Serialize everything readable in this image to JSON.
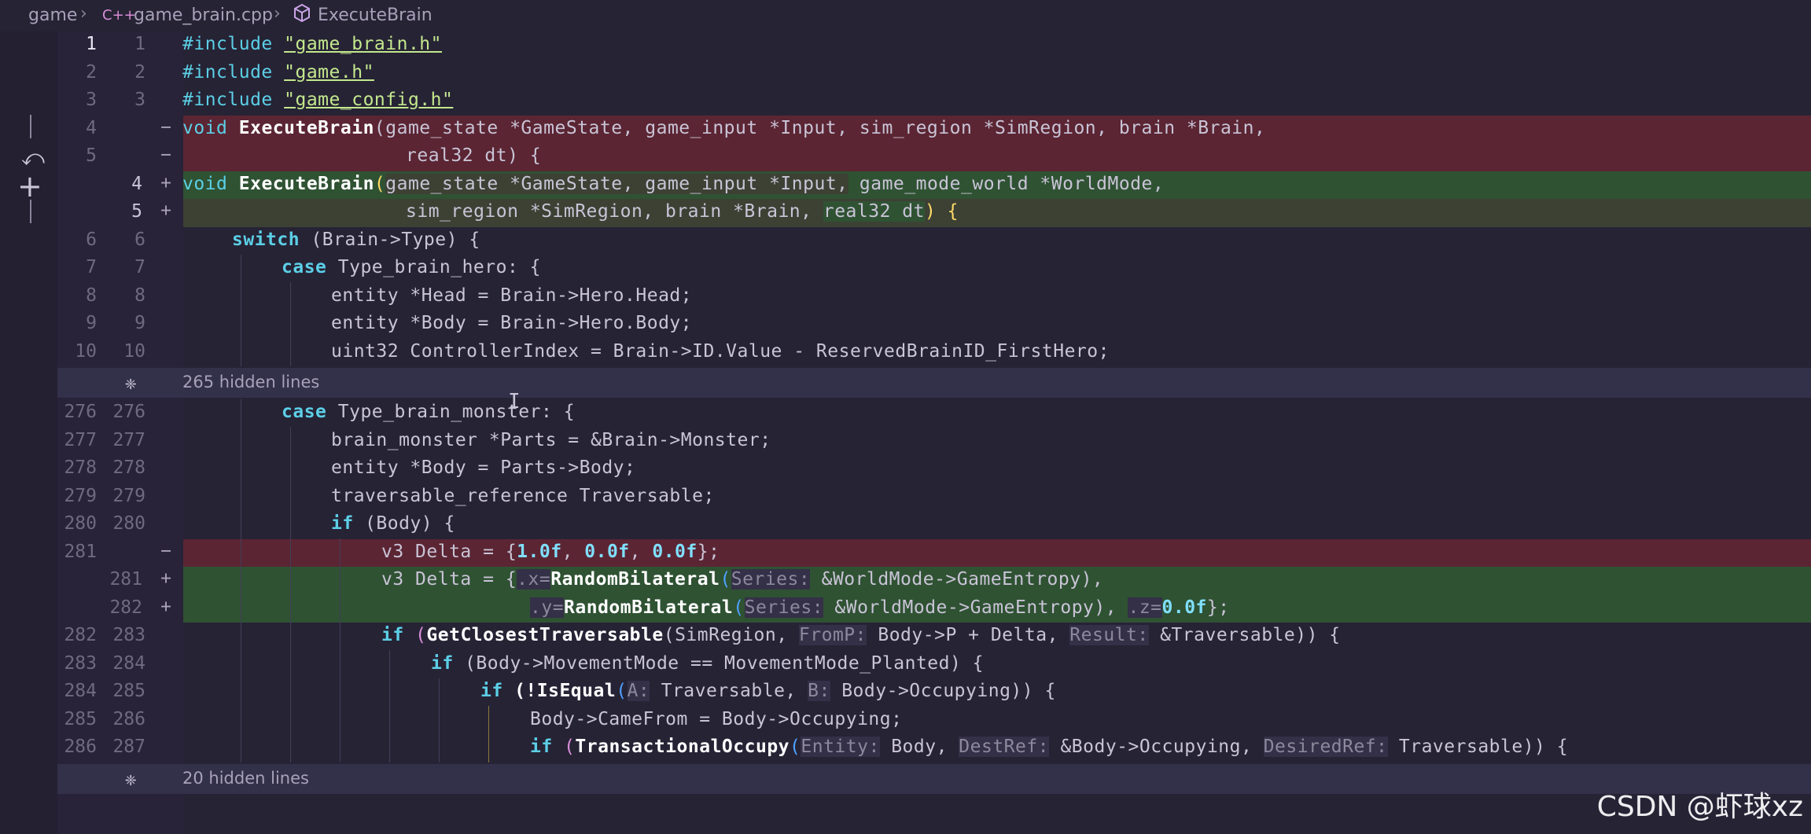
{
  "breadcrumb": {
    "folder": "game",
    "file": "game_brain.cpp",
    "symbol": "ExecuteBrain"
  },
  "hidden_sections": [
    {
      "label": "265 hidden lines"
    },
    {
      "label": "20 hidden lines"
    }
  ],
  "lines": [
    {
      "old": "1",
      "new": "1",
      "kind": "ctx",
      "current": true
    },
    {
      "old": "2",
      "new": "2",
      "kind": "ctx"
    },
    {
      "old": "3",
      "new": "3",
      "kind": "ctx"
    },
    {
      "old": "4",
      "new": "",
      "kind": "del",
      "mark": "−"
    },
    {
      "old": "5",
      "new": "",
      "kind": "del",
      "mark": "−"
    },
    {
      "old": "",
      "new": "4",
      "kind": "add",
      "mark": "+"
    },
    {
      "old": "",
      "new": "5",
      "kind": "addlite",
      "mark": "+"
    },
    {
      "old": "6",
      "new": "6",
      "kind": "ctx"
    },
    {
      "old": "7",
      "new": "7",
      "kind": "ctx"
    },
    {
      "old": "8",
      "new": "8",
      "kind": "ctx"
    },
    {
      "old": "9",
      "new": "9",
      "kind": "ctx"
    },
    {
      "old": "10",
      "new": "10",
      "kind": "ctx"
    },
    {
      "old": "276",
      "new": "276",
      "kind": "ctx"
    },
    {
      "old": "277",
      "new": "277",
      "kind": "ctx"
    },
    {
      "old": "278",
      "new": "278",
      "kind": "ctx"
    },
    {
      "old": "279",
      "new": "279",
      "kind": "ctx"
    },
    {
      "old": "280",
      "new": "280",
      "kind": "ctx"
    },
    {
      "old": "281",
      "new": "",
      "kind": "del",
      "mark": "−"
    },
    {
      "old": "",
      "new": "281",
      "kind": "add",
      "mark": "+"
    },
    {
      "old": "",
      "new": "282",
      "kind": "add",
      "mark": "+"
    },
    {
      "old": "282",
      "new": "283",
      "kind": "ctx"
    },
    {
      "old": "283",
      "new": "284",
      "kind": "ctx"
    },
    {
      "old": "284",
      "new": "285",
      "kind": "ctx"
    },
    {
      "old": "285",
      "new": "286",
      "kind": "ctx"
    },
    {
      "old": "286",
      "new": "287",
      "kind": "ctx"
    }
  ],
  "code": {
    "l1_inc": "#include",
    "l1_str": "\"game_brain.h\"",
    "l2_inc": "#include",
    "l2_str": "\"game.h\"",
    "l3_inc": "#include",
    "l3_str": "\"game_config.h\"",
    "l4_void": "void",
    "l4_fn": "ExecuteBrain",
    "l4_args": "(game_state *GameState, game_input *Input, sim_region *SimRegion, brain *Brain,",
    "l5_args": "real32 dt) {",
    "a4_void": "void",
    "a4_fn": "ExecuteBrain",
    "a4_args1": "game_state *GameState, game_input *Input,",
    "a4_args2": "game_mode_world *WorldMode,",
    "a5_args1": "sim_region *SimRegion, brain *Brain,",
    "a5_args2": "real32 dt",
    "a5_end": ") {",
    "l6_kw": "switch",
    "l6_rest": "(Brain->Type) {",
    "l7_kw": "case",
    "l7_rest": "Type_brain_hero: {",
    "l8": "entity *Head = Brain->Hero.Head;",
    "l9": "entity *Body = Brain->Hero.Body;",
    "l10": "uint32 ControllerIndex = Brain->ID.Value - ReservedBrainID_FirstHero;",
    "l276_kw": "case",
    "l276_rest": "Type_brain_monster: {",
    "l277": "brain_monster *Parts = &Brain->Monster;",
    "l278": "entity *Body = Parts->Body;",
    "l279": "traversable_reference Traversable;",
    "l280_kw": "if",
    "l280_rest": "(Body) {",
    "d281_pre": "v3 Delta = {",
    "d281_n1": "1.0f",
    "d281_n2": "0.0f",
    "d281_n3": "0.0f",
    "d281_end": "};",
    "a281_pre": "v3 Delta = {",
    "a281_x": ".x=",
    "a281_fn": "RandomBilateral",
    "a281_hint": "Series:",
    "a281_arg": "&WorldMode->GameEntropy),",
    "a282_y": ".y=",
    "a282_fn": "RandomBilateral",
    "a282_hint": "Series:",
    "a282_arg": "&WorldMode->GameEntropy),",
    "a282_z": ".z=",
    "a282_num": "0.0f",
    "a282_end": "};",
    "l283_kw": "if",
    "l283_fn": "GetClosestTraversable",
    "l283_a1": "(SimRegion,",
    "l283_h1": "FromP:",
    "l283_a2": "Body->P + Delta,",
    "l283_h2": "Result:",
    "l283_a3": "&Traversable)) {",
    "l284_kw": "if",
    "l284_rest": "(Body->MovementMode == MovementMode_Planted) {",
    "l285_kw": "if",
    "l285_fn": "(!IsEqual",
    "l285_h1": "A:",
    "l285_a1": "Traversable,",
    "l285_h2": "B:",
    "l285_a2": "Body->Occupying)) {",
    "l286": "Body->CameFrom = Body->Occupying;",
    "l287_kw": "if",
    "l287_fn": "TransactionalOccupy",
    "l287_h1": "Entity:",
    "l287_a1": "Body,",
    "l287_h2": "DestRef:",
    "l287_a2": "&Body->Occupying,",
    "l287_h3": "DesiredRef:",
    "l287_a3": "Traversable)) {"
  },
  "watermark": "CSDN @虾球xz"
}
